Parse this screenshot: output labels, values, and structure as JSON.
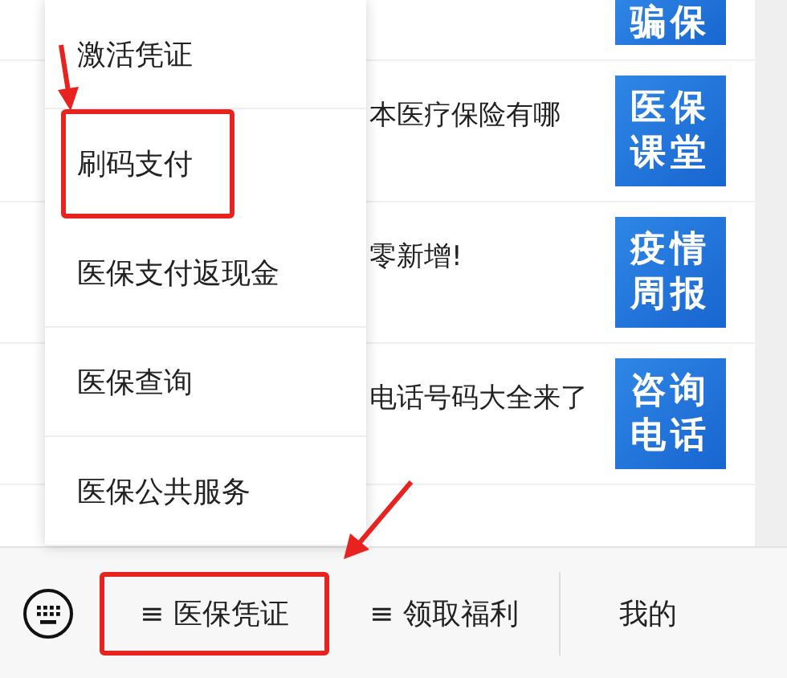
{
  "articles": [
    {
      "thumb_lines": [
        "骗保"
      ]
    },
    {
      "title": "本医疗保险有哪",
      "thumb_lines": [
        "医保",
        "课堂"
      ]
    },
    {
      "title": "零新增!",
      "thumb_lines": [
        "疫情",
        "周报"
      ]
    },
    {
      "title": "电话号码大全来了",
      "thumb_lines": [
        "咨询",
        "电话"
      ]
    }
  ],
  "menu": {
    "items": [
      {
        "label": "激活凭证",
        "highlighted": false
      },
      {
        "label": "刷码支付",
        "highlighted": true
      },
      {
        "label": "医保支付返现金",
        "highlighted": false
      },
      {
        "label": "医保查询",
        "highlighted": false
      },
      {
        "label": "医保公共服务",
        "highlighted": false
      }
    ]
  },
  "bottom_bar": {
    "tabs": [
      {
        "icon": "≡",
        "label": "医保凭证",
        "highlighted": true
      },
      {
        "icon": "≡",
        "label": "领取福利",
        "highlighted": false
      },
      {
        "label": "我的",
        "highlighted": false
      }
    ]
  }
}
